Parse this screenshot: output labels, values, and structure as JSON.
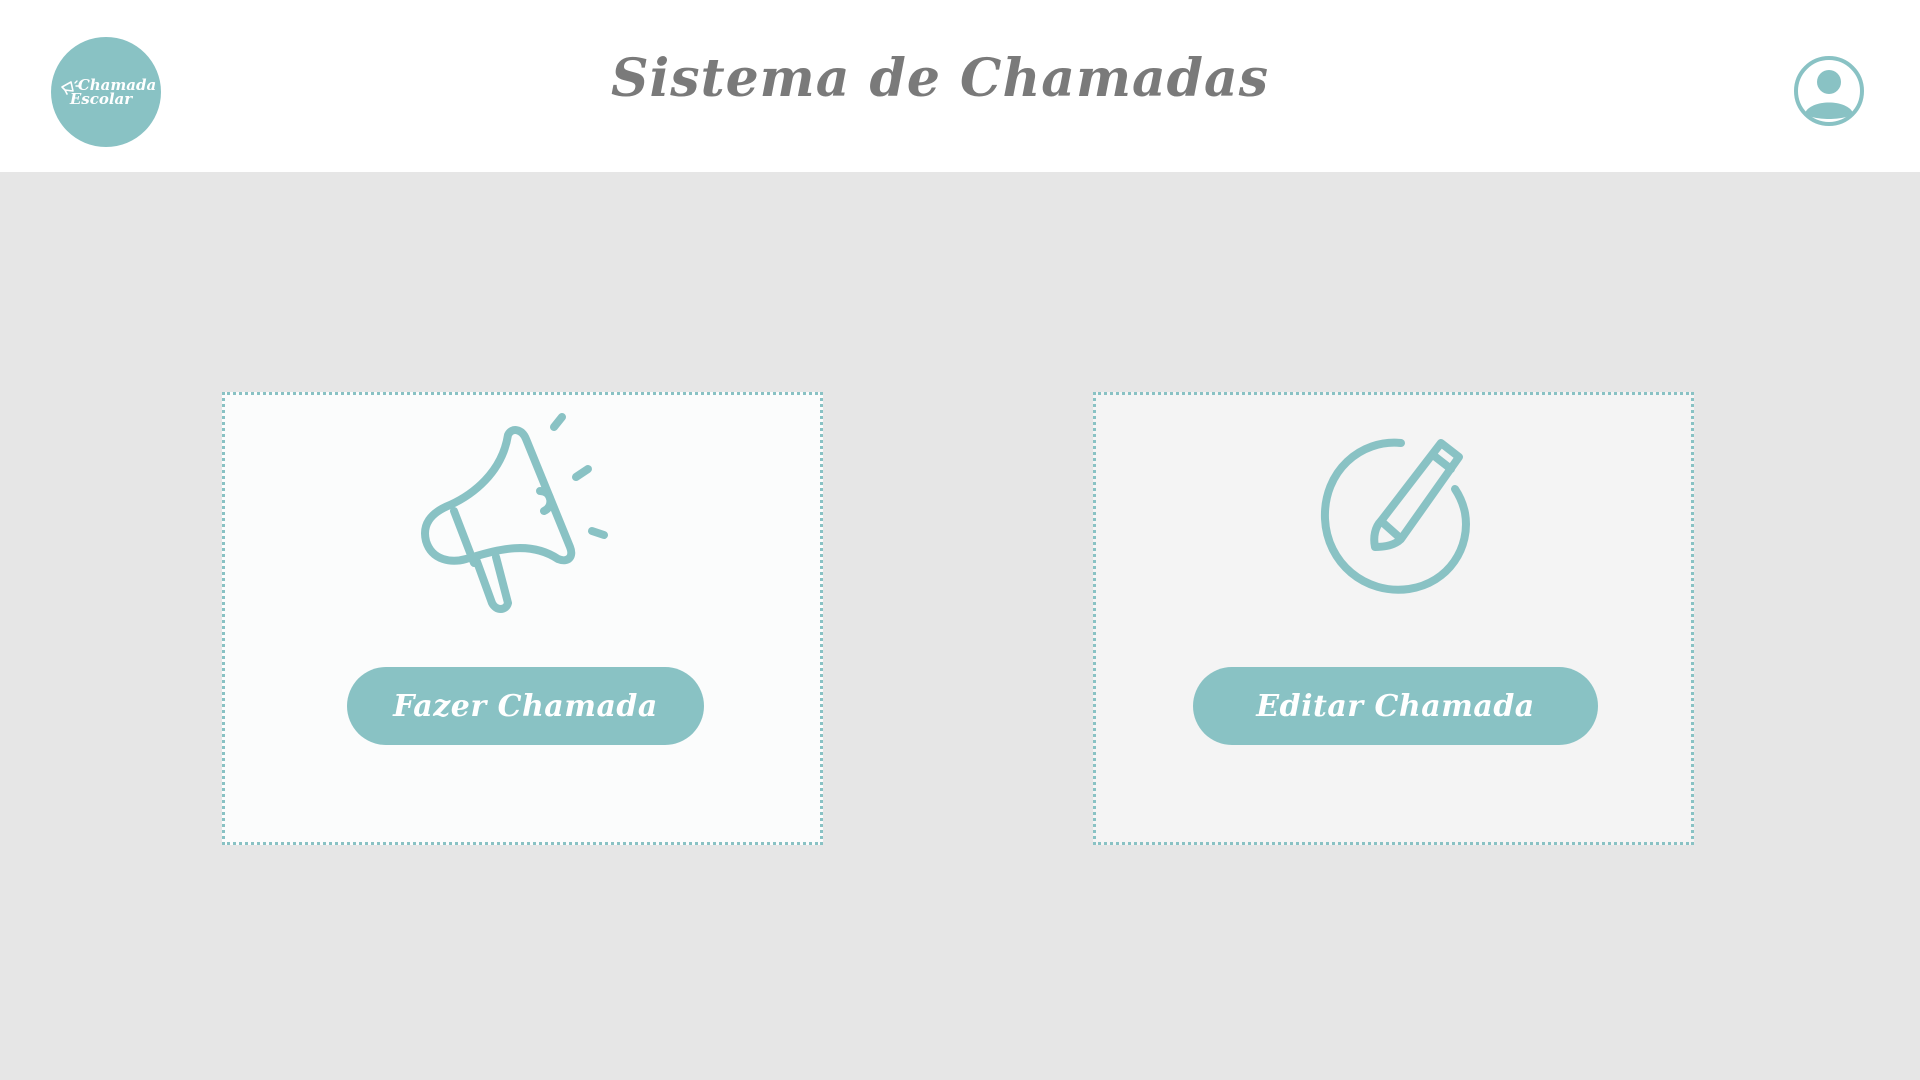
{
  "header": {
    "logo": {
      "line1": "Chamada",
      "line2": "Escolar",
      "icon": "megaphone-icon"
    },
    "title": "Sistema de Chamadas",
    "avatar_icon": "user-avatar-icon"
  },
  "cards": [
    {
      "icon": "megaphone-icon",
      "button_label": "Fazer Chamada"
    },
    {
      "icon": "edit-pencil-icon",
      "button_label": "Editar Chamada"
    }
  ],
  "colors": {
    "accent": "#89c2c4",
    "header_bg": "#ffffff",
    "page_bg": "#e6e6e6",
    "title": "#7a7a7a"
  }
}
